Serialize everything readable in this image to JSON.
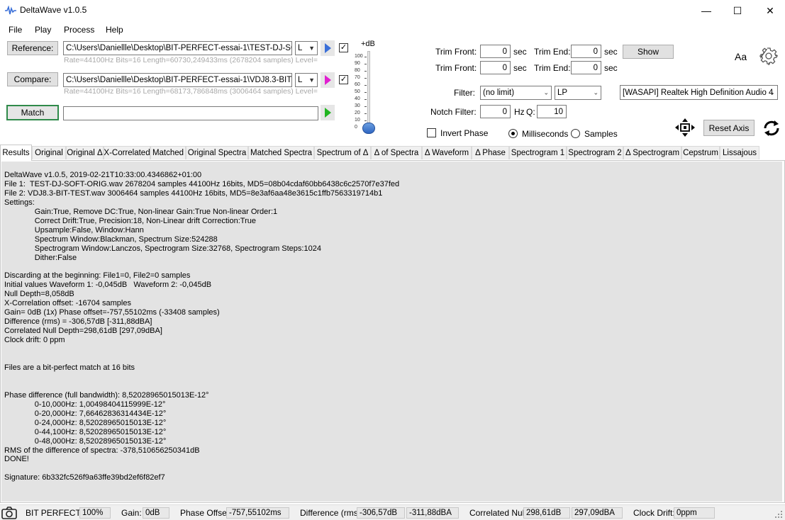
{
  "window": {
    "title": "DeltaWave v1.0.5",
    "minimize": "—",
    "maximize": "☐",
    "close": "✕"
  },
  "menu": [
    "File",
    "Play",
    "Process",
    "Help"
  ],
  "reference": {
    "button": "Reference:",
    "path": "C:\\Users\\Daniellle\\Desktop\\BIT-PERFECT-essai-1\\TEST-DJ-SOFT",
    "channel": "L",
    "info": "Rate=44100Hz Bits=16 Length=60730,249433ms (2678204 samples) Level="
  },
  "compare": {
    "button": "Compare:",
    "path": "C:\\Users\\Daniellle\\Desktop\\BIT-PERFECT-essai-1\\VDJ8.3-BIT-TE",
    "channel": "L",
    "info": "Rate=44100Hz Bits=16 Length=68173,786848ms (3006464 samples) Level="
  },
  "match": {
    "button": "Match",
    "value": ""
  },
  "level_slider": {
    "label": "+dB",
    "ticks": [
      "100",
      "90",
      "80",
      "70",
      "60",
      "50",
      "40",
      "30",
      "20",
      "10",
      "0"
    ]
  },
  "trim": {
    "front_label": "Trim Front:",
    "end_label": "Trim End:",
    "unit": "sec",
    "ref_front": "0",
    "ref_end": "0",
    "cmp_front": "0",
    "cmp_end": "0",
    "show_button": "Show"
  },
  "filter": {
    "label": "Filter:",
    "value": "(no limit)",
    "type": "LP",
    "device": "[WASAPI] Realtek High Definition Audio 4"
  },
  "notch": {
    "label": "Notch Filter:",
    "value": "0",
    "hz": "Hz",
    "q_label": "Q:",
    "q_value": "10"
  },
  "options": {
    "invert_phase": "Invert Phase",
    "milliseconds": "Milliseconds",
    "samples": "Samples",
    "reset_axis": "Reset Axis",
    "font_button": "Aa"
  },
  "tabs": [
    "Results",
    "Original",
    "Original Δ",
    "X-Correlated",
    "Matched",
    "Original Spectra",
    "Matched Spectra",
    "Spectrum of Δ",
    "Δ of Spectra",
    "Δ Waveform",
    "Δ Phase",
    "Spectrogram 1",
    "Spectrogram 2",
    "Δ Spectrogram",
    "Cepstrum",
    "Lissajous"
  ],
  "results": [
    "DeltaWave v1.0.5, 2019-02-21T10:33:00.4346862+01:00",
    "File 1:  TEST-DJ-SOFT-ORIG.wav 2678204 samples 44100Hz 16bits, MD5=08b04cdaf60bb6438c6c2570f7e37fed",
    "File 2: VDJ8.3-BIT-TEST.wav 3006464 samples 44100Hz 16bits, MD5=8e3af6aa48e3615c1ffb7563319714b1",
    "Settings:",
    "              Gain:True, Remove DC:True, Non-linear Gain:True Non-linear Order:1",
    "              Correct Drift:True, Precision:18, Non-Linear drift Correction:True",
    "              Upsample:False, Window:Hann",
    "              Spectrum Window:Blackman, Spectrum Size:524288",
    "              Spectrogram Window:Lanczos, Spectrogram Size:32768, Spectrogram Steps:1024",
    "              Dither:False",
    "",
    "Discarding at the beginning: File1=0, File2=0 samples",
    "Initial values Waveform 1: -0,045dB   Waveform 2: -0,045dB",
    "Null Depth=8,058dB",
    "X-Correlation offset: -16704 samples",
    "Gain= 0dB (1x) Phase offset=-757,55102ms (-33408 samples)",
    "Difference (rms) = -306,57dB [-311,88dBA]",
    "Correlated Null Depth=298,61dB [297,09dBA]",
    "Clock drift: 0 ppm",
    "",
    "",
    "Files are a bit-perfect match at 16 bits",
    "",
    "",
    "Phase difference (full bandwidth): 8,52028965015013E-12°",
    "              0-10,000Hz: 1,00498404115999E-12°",
    "              0-20,000Hz: 7,66462836314434E-12°",
    "              0-24,000Hz: 8,52028965015013E-12°",
    "              0-44,100Hz: 8,52028965015013E-12°",
    "              0-48,000Hz: 8,52028965015013E-12°",
    "RMS of the difference of spectra: -378,510656250341dB",
    "DONE!",
    "",
    "Signature: 6b332fc526f9a63ffe39bd2ef6f82ef7"
  ],
  "status": {
    "bitperfect_label": "BIT PERFECT!",
    "bitperfect_value": "100%",
    "gain_label": "Gain:",
    "gain_value": "0dB",
    "phase_label": "Phase Offset:",
    "phase_value": "-757,55102ms",
    "diff_label": "Difference (rms):",
    "diff_value": "-306,57dB",
    "diff_value_a": "-311,88dBA",
    "null_label": "Correlated Null:",
    "null_value": "298,61dB",
    "null_value_a": "297,09dBA",
    "drift_label": "Clock Drift:",
    "drift_value": "0ppm"
  },
  "colors": {
    "match_border": "#2f8a4a",
    "play_blue": "#3a6fd8",
    "play_magenta": "#e020d0",
    "play_green": "#22b522",
    "results_bg": "#e3e3e3"
  }
}
